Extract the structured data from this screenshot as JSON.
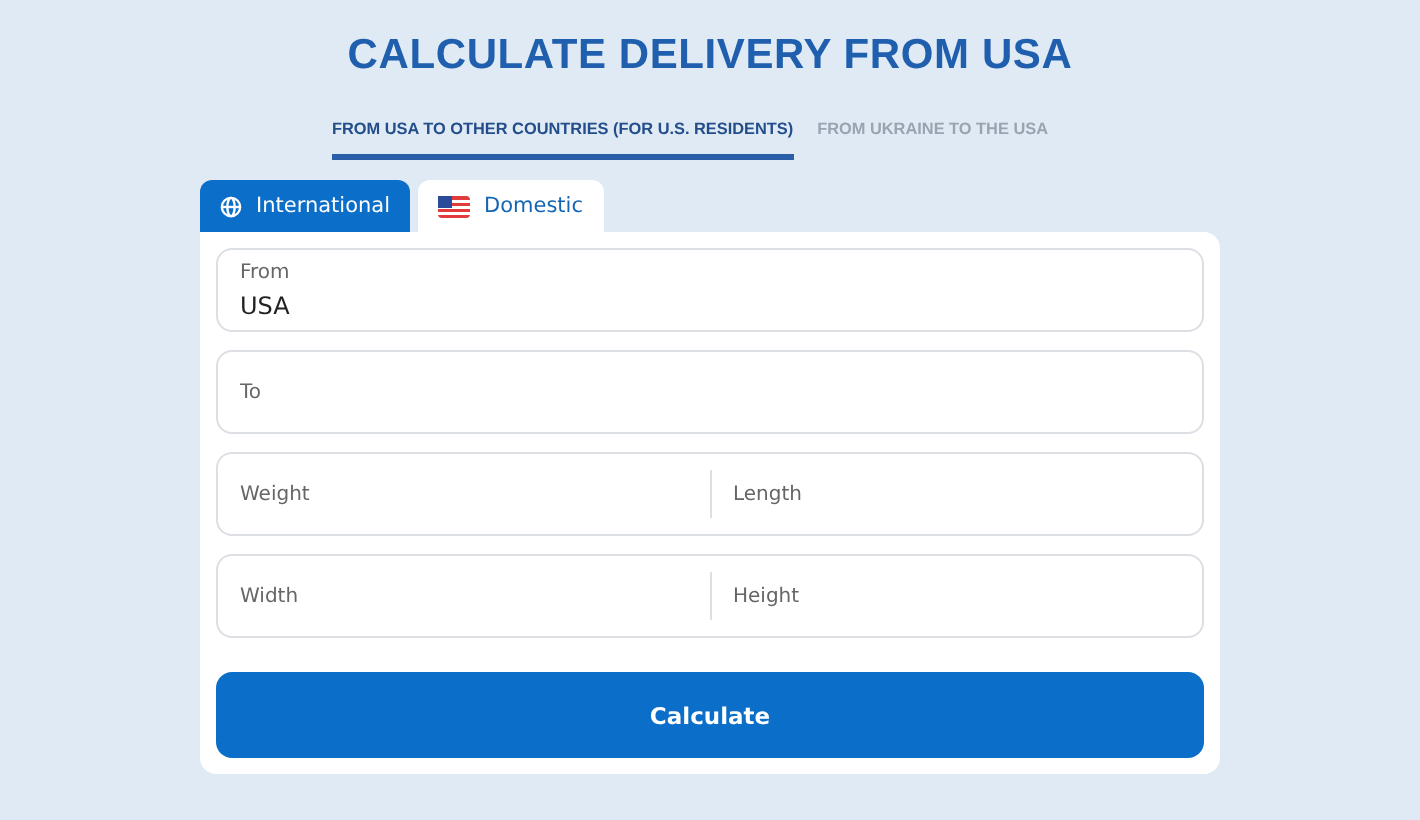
{
  "title": "CALCULATE DELIVERY FROM USA",
  "route_tabs": [
    {
      "label": "FROM USA TO OTHER COUNTRIES (FOR U.S. RESIDENTS)",
      "selected": true
    },
    {
      "label": "FROM UKRAINE TO THE USA",
      "selected": false
    }
  ],
  "mode_tabs": [
    {
      "label": "International",
      "selected": true
    },
    {
      "label": "Domestic",
      "selected": false
    }
  ],
  "fields": [
    {
      "kind": "labeled",
      "label": "From",
      "value": "USA"
    },
    {
      "kind": "single",
      "placeholder": "To"
    },
    {
      "kind": "pair",
      "placeholders": [
        "Weight",
        "Length"
      ]
    },
    {
      "kind": "pair",
      "placeholders": [
        "Width",
        "Height"
      ]
    }
  ],
  "button": "Calculate"
}
